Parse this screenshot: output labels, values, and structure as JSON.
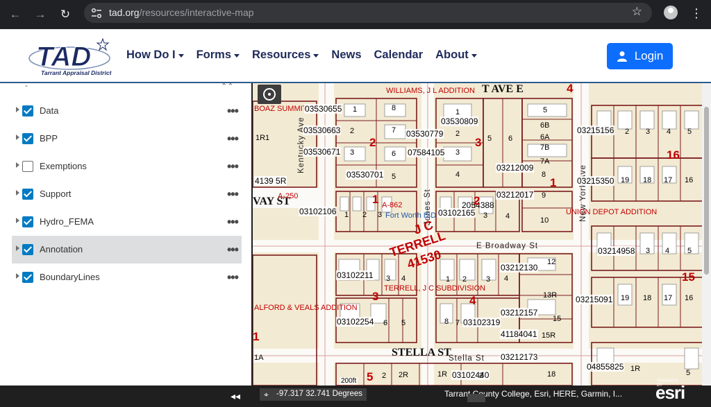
{
  "browser": {
    "url_host": "tad.org",
    "url_path": "/resources/interactive-map",
    "back_icon": "arrow-left-icon",
    "forward_icon": "arrow-right-icon",
    "reload_icon": "reload-icon",
    "bookmark_icon": "star-icon"
  },
  "header": {
    "logo_text": "TAD",
    "logo_tagline": "Tarrant Appraisal District",
    "nav": [
      {
        "label": "How Do I",
        "dropdown": true
      },
      {
        "label": "Forms",
        "dropdown": true
      },
      {
        "label": "Resources",
        "dropdown": true
      },
      {
        "label": "News",
        "dropdown": false
      },
      {
        "label": "Calendar",
        "dropdown": false
      },
      {
        "label": "About",
        "dropdown": true
      }
    ],
    "login_label": "Login",
    "brand_color": "#1e2a5a",
    "login_color": "#0d6efd"
  },
  "layers": {
    "items": [
      {
        "label": "Data",
        "checked": true,
        "selected": false
      },
      {
        "label": "BPP",
        "checked": true,
        "selected": false
      },
      {
        "label": "Exemptions",
        "checked": false,
        "selected": false
      },
      {
        "label": "Support",
        "checked": true,
        "selected": false
      },
      {
        "label": "Hydro_FEMA",
        "checked": true,
        "selected": false
      },
      {
        "label": "Annotation",
        "checked": true,
        "selected": true
      },
      {
        "label": "BoundaryLines",
        "checked": true,
        "selected": false
      }
    ],
    "more_symbol": "•••",
    "collapse_symbol": "◂◂"
  },
  "map": {
    "streets": [
      "T AVE E",
      "STELLA ST",
      "Stella St",
      "E Broadway St",
      "VAY ST",
      "Kentucky Ave",
      "New York Ave",
      "Jones St"
    ],
    "subdivisions": [
      "WILLIAMS, J L ADDITION",
      "BOAZ SUMMIT",
      "UNION DEPOT ADDITION",
      "TERRELL, J C SUBDIVISION",
      "ALFORD & VEALS ADDITION"
    ],
    "isd": "Fort Worth ISD",
    "terrell_lines": [
      "J C",
      "TERRELL",
      "41530"
    ],
    "coordinates": "-97.317 32.741 Degrees",
    "attribution": "Tarrant County College, Esri, HERE, Garmin, I...",
    "esri": "esri",
    "esri_powered": "POWERED BY",
    "scale": "200ft"
  }
}
